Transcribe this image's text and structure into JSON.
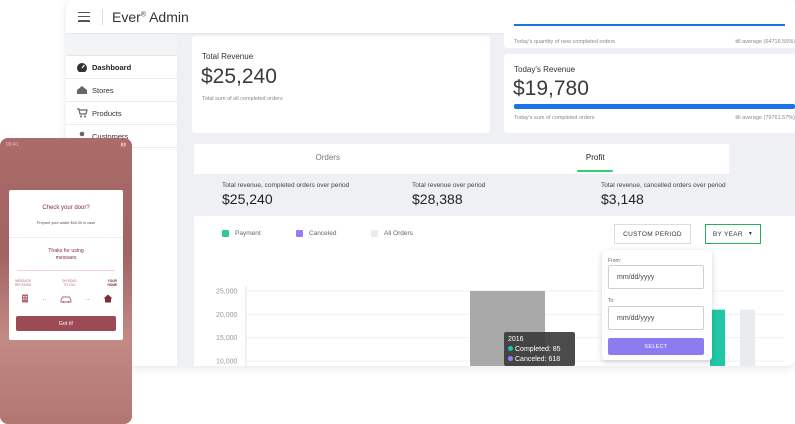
{
  "header": {
    "brand": "Ever",
    "brand_mark": "®",
    "brand_suffix": "Admin"
  },
  "sidebar": {
    "items": [
      {
        "label": "Dashboard",
        "icon": "dashboard-icon",
        "active": true
      },
      {
        "label": "Stores",
        "icon": "stores-icon",
        "active": false
      },
      {
        "label": "Products",
        "icon": "products-icon",
        "active": false
      },
      {
        "label": "Customers",
        "icon": "customers-icon",
        "active": false
      }
    ]
  },
  "cards": {
    "total_revenue": {
      "title": "Total Revenue",
      "value": "$25,240",
      "sub": "Total sum of all completed orders"
    },
    "completed_qty": {
      "sub_left": "Today's quantity of new completed orders",
      "sub_right": "till average (64716.55%)"
    },
    "todays_revenue": {
      "title": "Today's Revenue",
      "value": "$19,780",
      "sub_left": "Today's sum of completed orders",
      "sub_right": "till average (79761.57%)",
      "progress": 1.0
    }
  },
  "tabs": [
    {
      "label": "Orders",
      "active": false
    },
    {
      "label": "Profit",
      "active": true
    }
  ],
  "stats": [
    {
      "label": "Total revenue, completed orders over period",
      "value": "$25,240"
    },
    {
      "label": "Total revenue over period",
      "value": "$28,388"
    },
    {
      "label": "Total revenue, cancelled orders over period",
      "value": "$3,148"
    }
  ],
  "legend": [
    {
      "label": "Payment",
      "color": "#2ecc8f"
    },
    {
      "label": "Canceled",
      "color": "#9b7cf0"
    },
    {
      "label": "All Orders",
      "color": "#e8ecef"
    }
  ],
  "controls": {
    "custom_period": "CUSTOM PERIOD",
    "by_year": "BY YEAR"
  },
  "popover": {
    "from_label": "From:",
    "from_value": "mm/dd/yyyy",
    "to_label": "To:",
    "to_value": "mm/dd/yyyy",
    "select_label": "SELECT"
  },
  "chart_data": {
    "type": "bar",
    "y_ticks": [
      "25,000",
      "20,000",
      "15,000",
      "10,000"
    ],
    "ylim": [
      10000,
      25000
    ],
    "series": [
      {
        "name": "All Orders",
        "color": "#a9a9a9",
        "values": [
          25000
        ]
      },
      {
        "name": "Payment",
        "color": "#1fc7a6",
        "values": [
          21000
        ]
      },
      {
        "name": "All Orders",
        "color": "#e8ecef",
        "values": [
          21000
        ]
      }
    ],
    "tooltip": {
      "year": "2016",
      "completed": "Completed: 85",
      "canceled": "Canceled: 618",
      "completed_color": "#1fc7a6",
      "canceled_color": "#9b7cf0"
    }
  },
  "phone": {
    "time": "09:41",
    "title": "Check your door?",
    "subtitle": "Prepare your wallet $40.00 in cash",
    "thanks": "Thaks for using\nmessaes",
    "steps": [
      {
        "label": "MESSAGE\nRECEIVED",
        "strong": false
      },
      {
        "label": "ON ROAD\nTO YOU",
        "strong": false
      },
      {
        "label": "YOUR\nHOME",
        "strong": true
      }
    ],
    "button": "Got it!"
  }
}
